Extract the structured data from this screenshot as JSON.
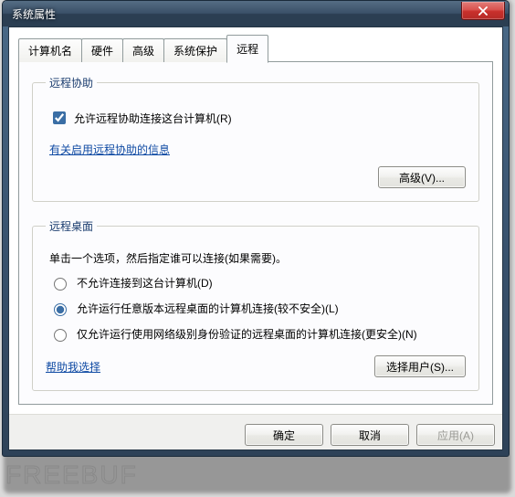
{
  "window": {
    "title": "系统属性"
  },
  "tabs": {
    "items": [
      {
        "label": "计算机名"
      },
      {
        "label": "硬件"
      },
      {
        "label": "高级"
      },
      {
        "label": "系统保护"
      },
      {
        "label": "远程"
      }
    ],
    "active_index": 4
  },
  "remote_assist": {
    "legend": "远程协助",
    "checkbox_label": "允许远程协助连接这台计算机(R)",
    "checkbox_checked": true,
    "info_link": "有关启用远程协助的信息",
    "advanced_button": "高级(V)..."
  },
  "remote_desktop": {
    "legend": "远程桌面",
    "description": "单击一个选项，然后指定谁可以连接(如果需要)。",
    "options": [
      {
        "label": "不允许连接到这台计算机(D)"
      },
      {
        "label": "允许运行任意版本远程桌面的计算机连接(较不安全)(L)"
      },
      {
        "label": "仅允许运行使用网络级别身份验证的远程桌面的计算机连接(更安全)(N)"
      }
    ],
    "selected_index": 1,
    "help_link": "帮助我选择",
    "select_users_button": "选择用户(S)..."
  },
  "buttons": {
    "ok": "确定",
    "cancel": "取消",
    "apply": "应用(A)"
  },
  "watermark": "FREEBUF"
}
